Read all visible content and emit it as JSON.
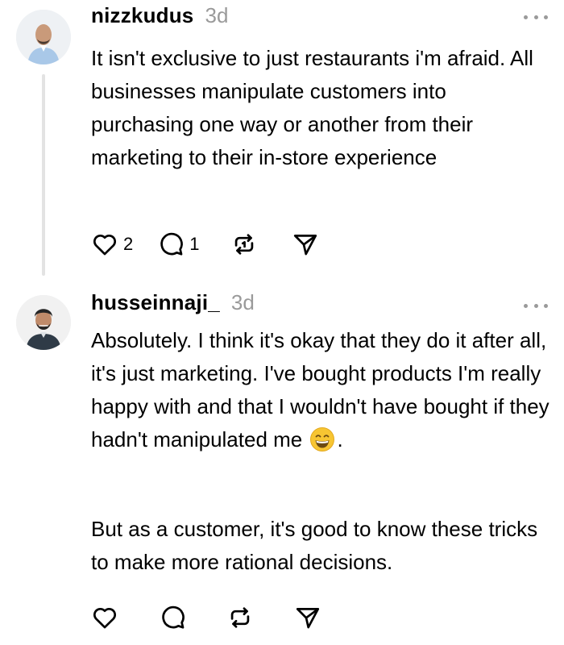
{
  "posts": [
    {
      "username": "nizzkudus",
      "timestamp": "3d",
      "paragraphs": [
        "It isn't exclusive to just restaurants i'm afraid. All businesses manipulate customers into purchasing one way or another from their marketing to their in-store experience"
      ],
      "likes": "2",
      "replies": "1"
    },
    {
      "username": "husseinnaji_",
      "timestamp": "3d",
      "paragraph_1_before_emoji": "Absolutely. I think it's okay that they do it after all, it's just marketing. I've bought products I'm really happy with and that I wouldn't have bought if they hadn't manipulated me",
      "paragraph_1_after_emoji": ".",
      "emoji": "grinning-face-emoji",
      "paragraph_2": "But as a customer, it's good to know these tricks to make more rational decisions."
    }
  ],
  "icons": {
    "like": "heart-icon",
    "reply": "comment-icon",
    "repost": "repost-icon",
    "share": "send-icon",
    "more": "more-icon"
  },
  "colors": {
    "text": "#000000",
    "muted": "#9a9a9a",
    "thread_line": "#e3e3e3"
  }
}
